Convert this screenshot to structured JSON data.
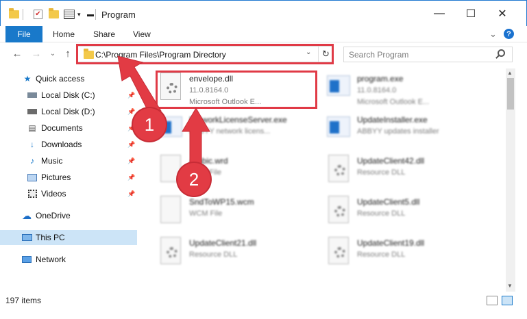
{
  "window": {
    "title": "Program",
    "minimize_glyph": "—",
    "maximize_glyph": "☐",
    "close_glyph": "✕"
  },
  "ribbon": {
    "tabs": [
      "File",
      "Home",
      "Share",
      "View"
    ],
    "collapse_glyph": "⌄",
    "help_glyph": "?"
  },
  "nav": {
    "back_glyph": "←",
    "forward_glyph": "→",
    "recent_glyph": "⌄",
    "up_glyph": "↑",
    "address": "C:\\Program Files\\Program Directory",
    "address_dropdown_glyph": "⌄",
    "refresh_glyph": "↻",
    "search_placeholder": "Search Program"
  },
  "sidebar": {
    "quick_access": "Quick access",
    "items": [
      {
        "label": "Local Disk (C:)",
        "icon": "drive-icon"
      },
      {
        "label": "Local Disk (D:)",
        "icon": "drive-icon"
      },
      {
        "label": "Documents",
        "icon": "documents-icon"
      },
      {
        "label": "Downloads",
        "icon": "downloads-icon"
      },
      {
        "label": "Music",
        "icon": "music-icon"
      },
      {
        "label": "Pictures",
        "icon": "pictures-icon"
      },
      {
        "label": "Videos",
        "icon": "videos-icon"
      }
    ],
    "onedrive": "OneDrive",
    "this_pc": "This PC",
    "network": "Network"
  },
  "files": {
    "highlighted": {
      "name": "envelope.dll",
      "version": "11.0.8164.0",
      "desc": "Microsoft Outlook E..."
    },
    "others": [
      {
        "name": "program.exe",
        "line1": "11.0.8164.0",
        "line2": "Microsoft Outlook E..."
      },
      {
        "name": "NetworkLicenseServer.exe",
        "line1": "ABBYY network licens..."
      },
      {
        "name": "UpdateInstaller.exe",
        "line1": "ABBYY updates installer"
      },
      {
        "name": "Arabic.wrd",
        "line1": "WRD File"
      },
      {
        "name": "UpdateClient42.dll",
        "line1": "Resource DLL"
      },
      {
        "name": "SndToWP15.wcm",
        "line1": "WCM File"
      },
      {
        "name": "UpdateClient5.dll",
        "line1": "Resource DLL"
      },
      {
        "name": "UpdateClient21.dll",
        "line1": "Resource DLL"
      },
      {
        "name": "UpdateClient19.dll",
        "line1": "Resource DLL"
      }
    ]
  },
  "status": {
    "items": "197 items"
  },
  "annotations": {
    "step1": "1",
    "step2": "2"
  },
  "colors": {
    "accent": "#1979ca",
    "highlight": "#e03a46",
    "selected": "#cce4f7"
  }
}
